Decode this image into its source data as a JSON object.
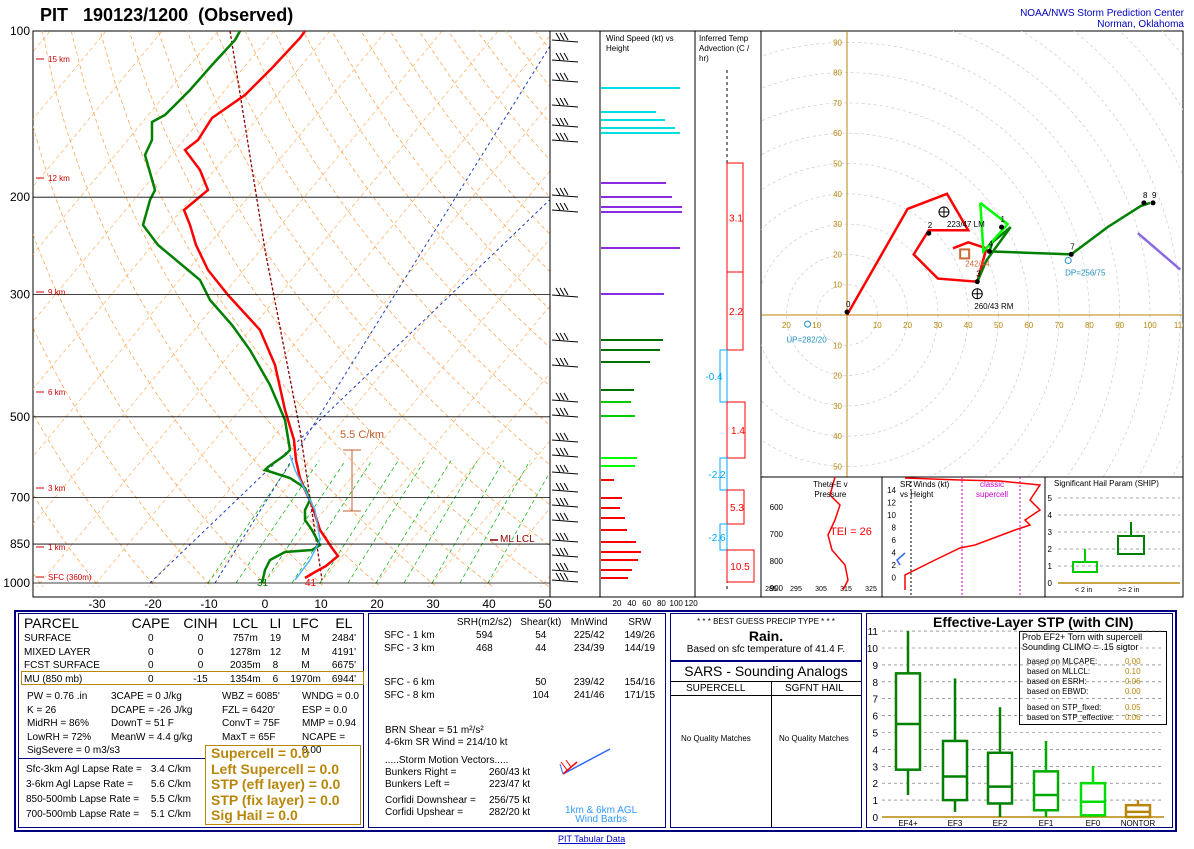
{
  "header": {
    "station": "PIT",
    "datetime": "190123/1200",
    "status": "(Observed)",
    "agency": "NOAA/NWS Storm Prediction Center",
    "location": "Norman, Oklahoma"
  },
  "footer_link": "PIT Tabular Data",
  "colors": {
    "temperature": "#ff0000",
    "dewpoint": "#008000",
    "wetbulb": "#00ffff",
    "parcel": "#8b0000",
    "isotherm": "#ffa500",
    "moist_adiabat": "#00a000",
    "dry_adiabat": "#ff8c00",
    "mixing_ratio": "#0000c0",
    "box_border": "#000080",
    "gold": "#b8860b"
  },
  "skewt": {
    "pressure_labels": [
      "100",
      "200",
      "300",
      "500",
      "700",
      "850",
      "1000"
    ],
    "height_labels": [
      "15 km",
      "12 km",
      "9 km",
      "6 km",
      "3 km",
      "1 km",
      "SFC (360m)"
    ],
    "temp_ticks": [
      "-30",
      "-20",
      "-10",
      "0",
      "10",
      "20",
      "30",
      "40",
      "50"
    ],
    "lapse_label": "5.5 C/km",
    "lcl_label": "ML LCL",
    "sfc_temp_label": "41",
    "sfc_dew_label": "31"
  },
  "chart_data": [
    {
      "type": "line",
      "title": "Skew-T log-P",
      "series": [
        {
          "name": "Temperature",
          "x": [
            5,
            5,
            4,
            2,
            -2,
            -5,
            -9,
            -14,
            -20,
            -27,
            -36,
            -45,
            -55,
            -56,
            -57
          ],
          "y": [
            1000,
            975,
            950,
            925,
            850,
            800,
            700,
            600,
            500,
            400,
            300,
            250,
            200,
            150,
            100
          ]
        },
        {
          "name": "Dewpoint",
          "x": [
            -1,
            2,
            3,
            2,
            -3,
            -8,
            -9,
            -11,
            -24,
            -34,
            -46,
            -55,
            -60,
            -62,
            -63
          ],
          "y": [
            1000,
            975,
            950,
            925,
            850,
            800,
            700,
            600,
            500,
            400,
            300,
            250,
            200,
            150,
            100
          ]
        }
      ],
      "ylim": [
        1050,
        100
      ],
      "xlim": [
        -30,
        50
      ]
    },
    {
      "type": "bar",
      "title": "Wind Speed (kt) vs Height",
      "ticks": [
        "20",
        "40",
        "60",
        "80",
        "100",
        "120"
      ],
      "xlim": [
        0,
        120
      ]
    },
    {
      "type": "bar",
      "title": "Inferred Temp Advection (C / hr)",
      "labels": [
        "3.1",
        "2.2",
        "-0.4",
        "1.4",
        "-2.2",
        "5.3",
        "-2.6",
        "10.5"
      ],
      "values": [
        3.1,
        2.2,
        -0.4,
        1.4,
        -2.2,
        5.3,
        -2.6,
        10.5
      ]
    },
    {
      "type": "line",
      "title": "Hodograph",
      "ticks": [
        "10",
        "20",
        "30",
        "40",
        "50",
        "60",
        "70",
        "80",
        "90",
        "100",
        "110"
      ],
      "annotations": [
        "223/47 LM",
        "242/44",
        "260/43 RM",
        "DP=256/75",
        "UP=282/20"
      ],
      "xlim": [
        -30,
        110
      ],
      "ylim": [
        -50,
        100
      ]
    },
    {
      "type": "bar",
      "title": "Significant Hail Param (SHIP)",
      "ylim": [
        0,
        5
      ],
      "categories": [
        "< 2 in",
        ">= 2 in"
      ]
    },
    {
      "type": "bar",
      "title": "Effective-Layer STP (with CIN)",
      "categories": [
        "EF4+",
        "EF3",
        "EF2",
        "EF1",
        "EF0",
        "NONTOR"
      ],
      "ylim": [
        0,
        11
      ]
    }
  ],
  "thetae": {
    "title1": "Theta-E v",
    "title2": "Pressure",
    "ticks": [
      "600",
      "700",
      "800",
      "900"
    ],
    "xticks": [
      "285",
      "295",
      "305",
      "315",
      "325"
    ],
    "tei_label": "TEI = 26"
  },
  "srwinds": {
    "title1": "SR Winds (kt)",
    "title2": "vs Height",
    "classic": "classic",
    "supercell": "supercell",
    "ticks": [
      "14",
      "12",
      "10",
      "8",
      "6",
      "4",
      "2",
      "0"
    ]
  },
  "ship": {
    "ticks": [
      "5",
      "4",
      "3",
      "2",
      "1",
      "0"
    ],
    "cat1": "< 2 in",
    "cat2": ">= 2 in"
  },
  "parcel_table": {
    "headers": [
      "PARCEL",
      "CAPE",
      "CINH",
      "LCL",
      "LI",
      "LFC",
      "EL"
    ],
    "rows": [
      [
        "SURFACE",
        "0",
        "0",
        "757m",
        "19",
        "M",
        "2484'"
      ],
      [
        "MIXED LAYER",
        "0",
        "0",
        "1278m",
        "12",
        "M",
        "4191'"
      ],
      [
        "FCST SURFACE",
        "0",
        "0",
        "2035m",
        "8",
        "M",
        "6675'"
      ],
      [
        "MU  (850 mb)",
        "0",
        "-15",
        "1354m",
        "6",
        "1970m",
        "6944'"
      ]
    ]
  },
  "indices": {
    "col1": [
      "PW = 0.76 .in",
      "K = 26",
      "MidRH = 86%",
      "LowRH = 72%",
      "SigSevere = 0 m3/s3"
    ],
    "col2": [
      "3CAPE = 0 J/kg",
      "DCAPE = -26 J/kg",
      "DownT = 51 F",
      "MeanW = 4.4 g/kg"
    ],
    "col3": [
      "WBZ = 6085'",
      "FZL = 6420'",
      "ConvT = 75F",
      "MaxT = 65F"
    ],
    "col4": [
      "WNDG = 0.0",
      "ESP = 0.0",
      "MMP = 0.94",
      "NCAPE = 0.00"
    ]
  },
  "lapse": [
    [
      "Sfc-3km Agl Lapse Rate =",
      "3.4 C/km"
    ],
    [
      "3-6km Agl Lapse Rate =",
      "5.6 C/km"
    ],
    [
      "850-500mb Lapse Rate =",
      "5.5 C/km"
    ],
    [
      "700-500mb Lapse Rate =",
      "5.1 C/km"
    ]
  ],
  "severe": [
    "Supercell = 0.0",
    "Left Supercell = 0.0",
    "STP (eff layer) = 0.0",
    "STP (fix layer) = 0.0",
    "Sig Hail = 0.0"
  ],
  "kinematic": {
    "headers": [
      "SRH(m2/s2)",
      "Shear(kt)",
      "MnWind",
      "SRW"
    ],
    "rows": [
      [
        "SFC - 1 km",
        "594",
        "54",
        "225/42",
        "149/26"
      ],
      [
        "SFC - 3 km",
        "468",
        "44",
        "234/39",
        "144/19"
      ],
      [
        "SFC - 6 km",
        "",
        "50",
        "239/42",
        "154/16"
      ],
      [
        "SFC - 8 km",
        "",
        "104",
        "241/46",
        "171/15"
      ]
    ],
    "brn": "BRN Shear =  51 m²/s²",
    "srwind": "4-6km SR Wind =        214/10 kt",
    "smv_title": ".....Storm Motion Vectors.....",
    "smv": [
      [
        "Bunkers Right =",
        "260/43 kt"
      ],
      [
        "Bunkers Left =",
        "223/47 kt"
      ],
      [
        "Corfidi Downshear =",
        "256/75 kt"
      ],
      [
        "Corfidi Upshear =",
        "282/20 kt"
      ]
    ],
    "barb_label1": "1km & 6km AGL",
    "barb_label2": "Wind Barbs"
  },
  "precip": {
    "title": "* * * BEST GUESS PRECIP TYPE * * *",
    "value": "Rain.",
    "detail": "Based on sfc temperature of 41.4 F."
  },
  "sars": {
    "title": "SARS - Sounding Analogs",
    "col1": "SUPERCELL",
    "col2": "SGFNT HAIL",
    "msg": "No Quality Matches"
  },
  "stp": {
    "title": "Effective-Layer STP (with CIN)",
    "prob1": "Prob EF2+ Torn with supercell",
    "prob2": "Sounding CLIMO = .15 sigtor",
    "items": [
      [
        "based on MLCAPE:",
        "0.00"
      ],
      [
        "based on MLLCL:",
        "0.10"
      ],
      [
        "based on ESRH:",
        "0.06"
      ],
      [
        "based on EBWD:",
        "0.00"
      ],
      [
        "based on STP_fixed:",
        "0.05"
      ],
      [
        "based on STP_effective:",
        "0.06"
      ]
    ],
    "yticks": [
      "11",
      "10",
      "9",
      "8",
      "7",
      "6",
      "5",
      "4",
      "3",
      "2",
      "1",
      "0"
    ],
    "cats": [
      "EF4+",
      "EF3",
      "EF2",
      "EF1",
      "EF0",
      "NONTOR"
    ]
  }
}
